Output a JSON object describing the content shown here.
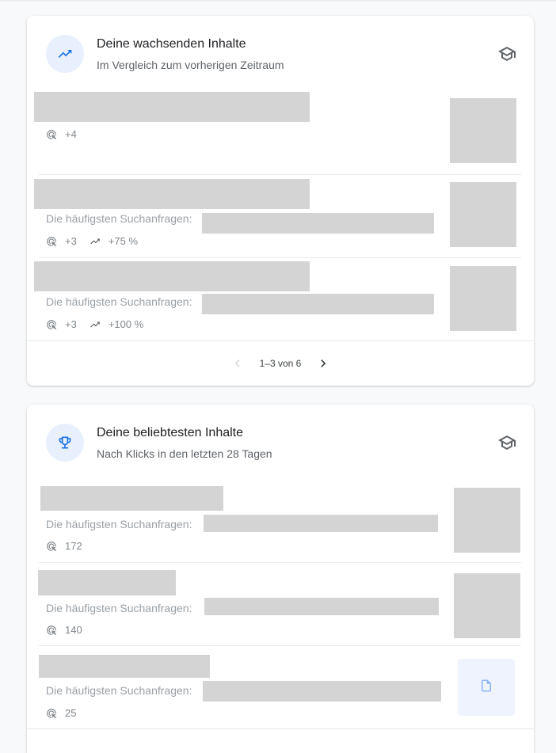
{
  "growing": {
    "title": "Deine wachsenden Inhalte",
    "subtitle": "Im Vergleich zum vorherigen Zeitraum",
    "items": [
      {
        "clicks": "+4"
      },
      {
        "queries_label": "Die häufigsten Suchanfragen:",
        "clicks": "+3",
        "growth": "+75 %"
      },
      {
        "queries_label": "Die häufigsten Suchanfragen:",
        "clicks": "+3",
        "growth": "+100 %"
      }
    ],
    "pagination": {
      "range": "1–3 von 6"
    }
  },
  "popular": {
    "title": "Deine beliebtesten Inhalte",
    "subtitle": "Nach Klicks in den letzten 28 Tagen",
    "items": [
      {
        "queries_label": "Die häufigsten Suchanfragen:",
        "clicks": "172"
      },
      {
        "queries_label": "Die häufigsten Suchanfragen:",
        "clicks": "140"
      },
      {
        "queries_label": "Die häufigsten Suchanfragen:",
        "clicks": "25"
      }
    ]
  },
  "icons": {
    "growing_header": "trending-up-icon",
    "popular_header": "trophy-icon",
    "help": "school-icon",
    "clicks": "click-icon",
    "growth": "trending-up-icon",
    "thumbnail_fallback": "document-icon"
  },
  "colors": {
    "accent": "#1a73e8",
    "icon_bg": "#e8f0fe",
    "placeholder": "#d4d4d4",
    "muted_text": "#80868b"
  }
}
